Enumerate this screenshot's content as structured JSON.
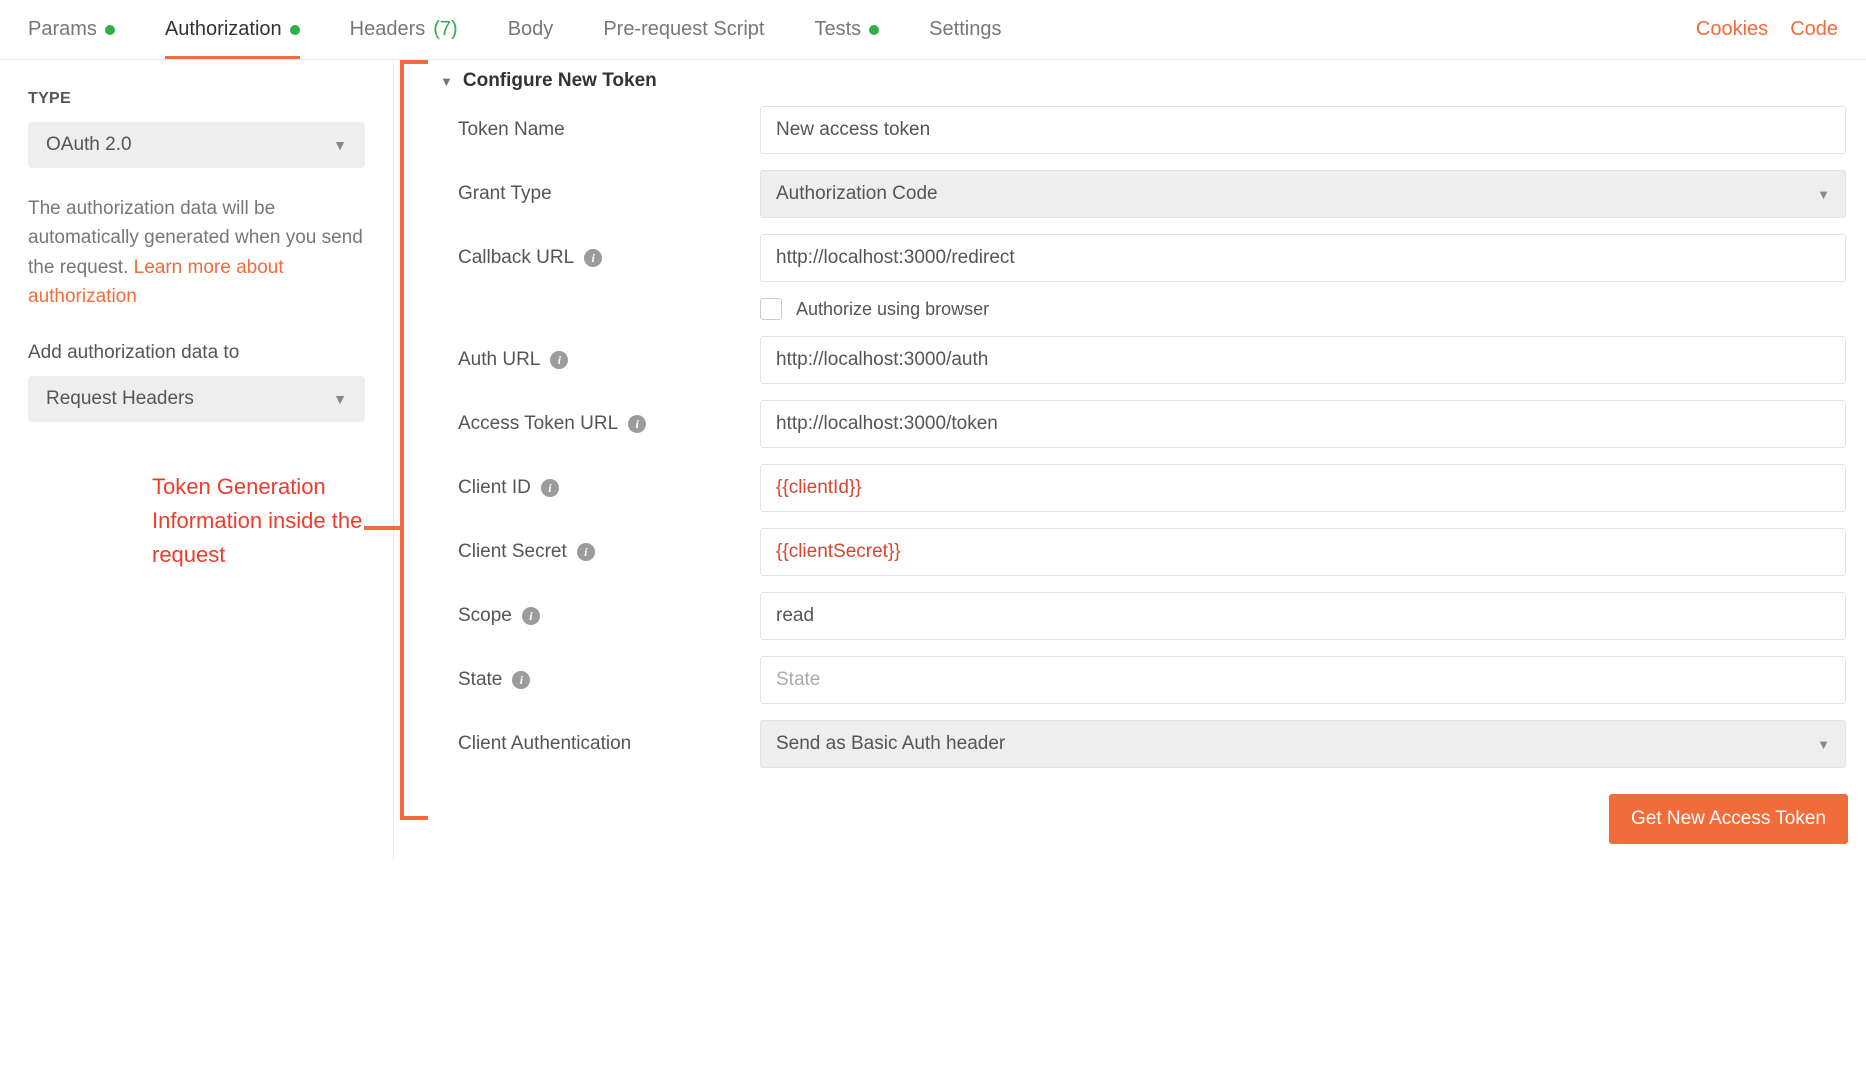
{
  "tabs": {
    "params": "Params",
    "authorization": "Authorization",
    "headers": "Headers",
    "headers_count": "(7)",
    "body": "Body",
    "prerequest": "Pre-request Script",
    "tests": "Tests",
    "settings": "Settings"
  },
  "right_links": {
    "cookies": "Cookies",
    "code": "Code"
  },
  "side": {
    "type_label": "TYPE",
    "type_value": "OAuth 2.0",
    "desc_text": "The authorization data will be automatically generated when you send the request. ",
    "learn_link": "Learn more about authorization",
    "addto_label": "Add authorization data to",
    "addto_value": "Request Headers"
  },
  "annotation": "Token Generation Information inside the request",
  "section_title": "Configure New Token",
  "form": {
    "token_name": {
      "label": "Token Name",
      "value": "New access token"
    },
    "grant_type": {
      "label": "Grant Type",
      "value": "Authorization Code"
    },
    "callback": {
      "label": "Callback URL",
      "value": "http://localhost:3000/redirect"
    },
    "authorize_browser": {
      "label": "Authorize using browser"
    },
    "auth_url": {
      "label": "Auth URL",
      "value": "http://localhost:3000/auth"
    },
    "token_url": {
      "label": "Access Token URL",
      "value": "http://localhost:3000/token"
    },
    "client_id": {
      "label": "Client ID",
      "value": "{{clientId}}"
    },
    "client_secret": {
      "label": "Client Secret",
      "value": "{{clientSecret}}"
    },
    "scope": {
      "label": "Scope",
      "value": "read"
    },
    "state": {
      "label": "State",
      "placeholder": "State"
    },
    "client_auth": {
      "label": "Client Authentication",
      "value": "Send as Basic Auth header"
    }
  },
  "button": "Get New Access Token"
}
